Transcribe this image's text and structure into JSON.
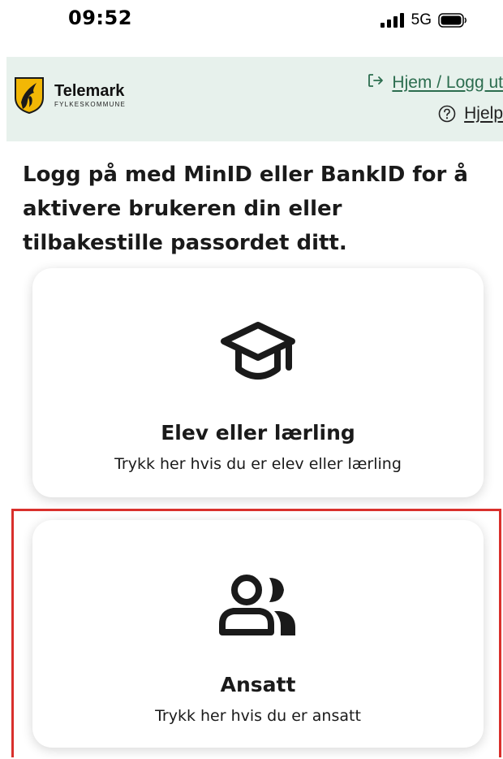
{
  "status_bar": {
    "time": "09:52",
    "network": "5G",
    "icons": [
      "signal-icon",
      "battery-icon"
    ]
  },
  "header": {
    "logo": {
      "name": "Telemark",
      "subtitle": "FYLKESKOMMUNE"
    },
    "home_link": {
      "icon": "login-icon",
      "label": "Hjem / Logg ut"
    },
    "help_link": {
      "icon": "help-circle-icon",
      "label": "Hjelp"
    },
    "background_color": "#e7f1ec",
    "link_color": "#2c6d4f"
  },
  "intro": {
    "text": "Logg på med MinID eller BankID for å aktivere brukeren din eller tilbakestille passordet ditt."
  },
  "cards": [
    {
      "icon": "graduation-cap-icon",
      "title": "Elev eller lærling",
      "description": "Trykk her hvis du er elev eller lærling"
    },
    {
      "icon": "users-icon",
      "title": "Ansatt",
      "description": "Trykk her hvis du er ansatt"
    }
  ],
  "highlight_color": "#d9302c"
}
